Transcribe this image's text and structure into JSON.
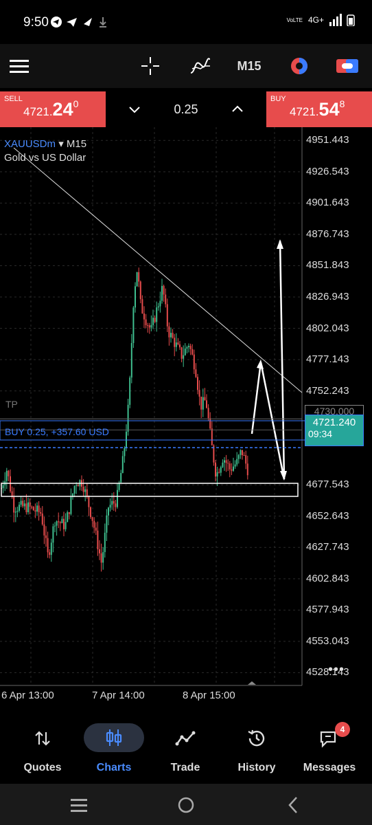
{
  "status": {
    "time": "9:50",
    "network": "4G+",
    "volte": "VoLTE"
  },
  "toolbar": {
    "timeframe": "M15"
  },
  "trade": {
    "sell_label": "SELL",
    "sell_price_small": "4721.",
    "sell_price_big": "24",
    "sell_price_sup": "0",
    "lot": "0.25",
    "buy_label": "BUY",
    "buy_price_small": "4721.",
    "buy_price_big": "54",
    "buy_price_sup": "8"
  },
  "chart": {
    "symbol": "XAUUSDm",
    "symbol_suffix": "▾ M15",
    "description": "Gold vs US Dollar",
    "tp_label": "TP",
    "tp_price": "4730.000",
    "position_label": "BUY 0.25,  +357.60 USD",
    "current_price": "4721.240",
    "countdown": "09:34",
    "entry_price_partial": "4707.140",
    "price_axis": [
      "4951.443",
      "4926.543",
      "4901.643",
      "4876.743",
      "4851.843",
      "4826.943",
      "4802.043",
      "4777.143",
      "4752.243",
      "4677.543",
      "4652.643",
      "4627.743",
      "4602.843",
      "4577.943",
      "4553.043",
      "4528.143"
    ],
    "time_axis": [
      "6 Apr 13:00",
      "7 Apr 14:00",
      "8 Apr 15:00"
    ],
    "more": "•••"
  },
  "chart_data": {
    "type": "candlestick",
    "symbol": "XAUUSDm",
    "timeframe": "M15",
    "ylim": [
      4518,
      4962
    ],
    "y_ticks": [
      4951.443,
      4926.543,
      4901.643,
      4876.743,
      4851.843,
      4826.943,
      4802.043,
      4777.143,
      4752.243,
      4677.543,
      4652.643,
      4627.743,
      4602.843,
      4577.943,
      4553.043,
      4528.143
    ],
    "x_ticks": [
      "6 Apr 13:00",
      "7 Apr 14:00",
      "8 Apr 15:00"
    ],
    "levels": {
      "take_profit": 4730.0,
      "bid": 4721.24,
      "entry": 4707.14
    },
    "colors": {
      "up": "#3fbf8f",
      "down": "#e74c4c",
      "position": "#3a7bff",
      "current": "#26a69a"
    }
  },
  "nav": {
    "items": [
      {
        "label": "Quotes"
      },
      {
        "label": "Charts"
      },
      {
        "label": "Trade"
      },
      {
        "label": "History"
      },
      {
        "label": "Messages",
        "badge": "4"
      }
    ]
  }
}
